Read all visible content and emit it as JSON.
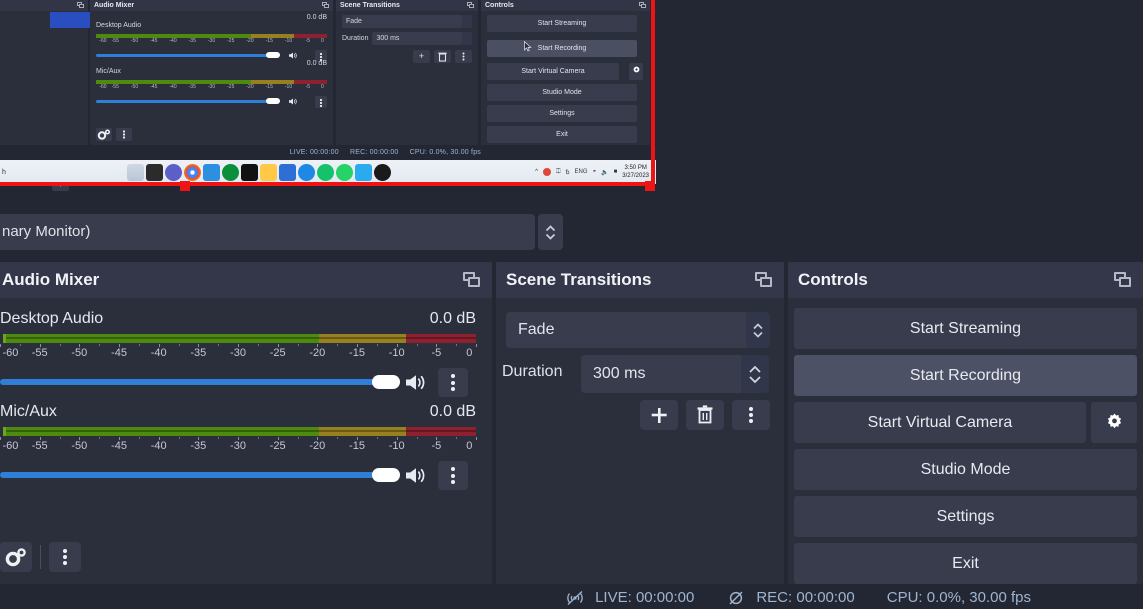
{
  "app": {
    "name": "OBS Studio"
  },
  "mini_screenshot": {
    "panels": {
      "audio_mixer": {
        "title": "Audio Mixer",
        "channels": [
          {
            "name": "Desktop Audio",
            "db": "0.0 dB"
          },
          {
            "name": "Mic/Aux",
            "db": "0.0 dB"
          }
        ]
      },
      "scene_transitions": {
        "title": "Scene Transitions",
        "transition": "Fade",
        "duration_label": "Duration",
        "duration": "300 ms",
        "buttons": [
          "+",
          "trash-icon",
          "kebab-icon"
        ]
      },
      "controls": {
        "title": "Controls",
        "buttons": [
          "Start Streaming",
          "Start Recording",
          "Start Virtual Camera",
          "Studio Mode",
          "Settings",
          "Exit"
        ],
        "hovered": "Start Recording"
      }
    },
    "status": {
      "live": "LIVE: 00:00:00",
      "rec": "REC: 00:00:00",
      "cpu": "CPU: 0.0%, 30.00 fps"
    },
    "taskbar": {
      "search_fragment": "h",
      "language": "ENG",
      "time": "3:50 PM",
      "date": "3/27/2023",
      "icons": [
        "weather-widget",
        "notepad-icon",
        "teams-icon",
        "chrome-icon",
        "mail-icon",
        "qq-icon",
        "obs-icon",
        "file-explorer-icon",
        "store-icon",
        "edge-icon",
        "grammarly-icon",
        "whatsapp-icon",
        "telegram-icon",
        "firefox-icon"
      ],
      "tray_icons": [
        "chevron-up-icon",
        "antivirus-icon",
        "microphone-icon",
        "keyboard-icon",
        "wifi-icon",
        "volume-icon",
        "battery-icon"
      ]
    },
    "selection": {
      "color": "#ef1414"
    }
  },
  "source_bar": {
    "value": "nary Monitor)",
    "spinner": "updown-spinner"
  },
  "audio_mixer": {
    "title": "Audio Mixer",
    "popout_icon": "popout-icon",
    "channels": [
      {
        "name": "Desktop Audio",
        "db": "0.0 dB",
        "volume_percent": 100,
        "mute_icon": "speaker-icon",
        "menu_icon": "kebab-icon"
      },
      {
        "name": "Mic/Aux",
        "db": "0.0 dB",
        "volume_percent": 100,
        "mute_icon": "speaker-icon",
        "menu_icon": "kebab-icon"
      }
    ],
    "meter_scale": {
      "min": -60,
      "max": 0,
      "ticks": [
        "-60",
        "-55",
        "-50",
        "-45",
        "-40",
        "-35",
        "-30",
        "-25",
        "-20",
        "-15",
        "-10",
        "-5",
        "0"
      ],
      "green_until": -20,
      "yellow_until": -9,
      "colors": {
        "green": "#4f8a10",
        "yellow": "#97801f",
        "red": "#8e2130"
      }
    },
    "footer": {
      "advanced_icon": "gears-icon",
      "menu_icon": "kebab-icon"
    }
  },
  "scene_transitions": {
    "title": "Scene Transitions",
    "popout_icon": "popout-icon",
    "transition": "Fade",
    "transition_options": [
      "Fade"
    ],
    "duration_label": "Duration",
    "duration": "300 ms",
    "add_icon": "plus-icon",
    "remove_icon": "trash-icon",
    "menu_icon": "kebab-icon"
  },
  "controls": {
    "title": "Controls",
    "popout_icon": "popout-icon",
    "buttons": [
      {
        "label": "Start Streaming",
        "hovered": false
      },
      {
        "label": "Start Recording",
        "hovered": true
      },
      {
        "label": "Start Virtual Camera",
        "hovered": false,
        "has_gear": true
      },
      {
        "label": "Studio Mode",
        "hovered": false
      },
      {
        "label": "Settings",
        "hovered": false
      },
      {
        "label": "Exit",
        "hovered": false
      }
    ],
    "gear_icon": "gear-icon"
  },
  "status_bar": {
    "live_icon": "stream-off-icon",
    "live": "LIVE: 00:00:00",
    "rec_icon": "record-off-icon",
    "rec": "REC: 00:00:00",
    "cpu": "CPU: 0.0%, 30.00 fps"
  },
  "theme": {
    "background": "#232733",
    "panel": "#2b2e3b",
    "header": "#333749",
    "control": "#383c4c",
    "hover": "#4c5165",
    "accent": "#2f7ed8",
    "text": "#e6e8ef",
    "status_text": "#9fb4cf",
    "selection": "#ef1414"
  }
}
